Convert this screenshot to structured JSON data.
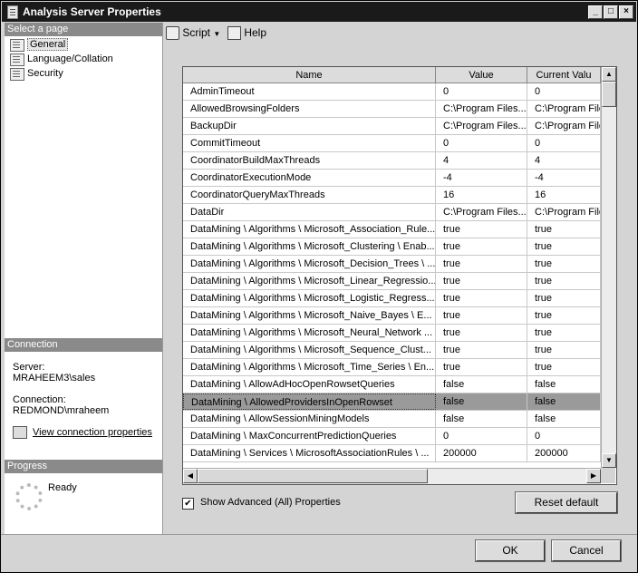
{
  "window": {
    "title": "Analysis Server Properties",
    "min": "_",
    "max": "□",
    "close": "×"
  },
  "sidebar": {
    "select_page_header": "Select a page",
    "pages": [
      {
        "label": "General",
        "selected": true
      },
      {
        "label": "Language/Collation",
        "selected": false
      },
      {
        "label": "Security",
        "selected": false
      }
    ],
    "connection_header": "Connection",
    "server_label": "Server:",
    "server_value": "MRAHEEM3\\sales",
    "connection_label": "Connection:",
    "connection_value": "REDMOND\\mraheem",
    "view_link": "View connection properties",
    "progress_header": "Progress",
    "progress_status": "Ready"
  },
  "toolbar": {
    "script_label": "Script",
    "help_label": "Help"
  },
  "grid": {
    "columns": [
      "Name",
      "Value",
      "Current Valu"
    ],
    "rows": [
      [
        "AdminTimeout",
        "0",
        "0"
      ],
      [
        "AllowedBrowsingFolders",
        "C:\\Program Files...",
        "C:\\Program File"
      ],
      [
        "BackupDir",
        "C:\\Program Files...",
        "C:\\Program File"
      ],
      [
        "CommitTimeout",
        "0",
        "0"
      ],
      [
        "CoordinatorBuildMaxThreads",
        "4",
        "4"
      ],
      [
        "CoordinatorExecutionMode",
        "-4",
        "-4"
      ],
      [
        "CoordinatorQueryMaxThreads",
        "16",
        "16"
      ],
      [
        "DataDir",
        "C:\\Program Files...",
        "C:\\Program File"
      ],
      [
        "DataMining \\ Algorithms \\ Microsoft_Association_Rule...",
        "true",
        "true"
      ],
      [
        "DataMining \\ Algorithms \\ Microsoft_Clustering \\ Enab...",
        "true",
        "true"
      ],
      [
        "DataMining \\ Algorithms \\ Microsoft_Decision_Trees \\ ...",
        "true",
        "true"
      ],
      [
        "DataMining \\ Algorithms \\ Microsoft_Linear_Regressio...",
        "true",
        "true"
      ],
      [
        "DataMining \\ Algorithms \\ Microsoft_Logistic_Regress...",
        "true",
        "true"
      ],
      [
        "DataMining \\ Algorithms \\ Microsoft_Naive_Bayes \\ E...",
        "true",
        "true"
      ],
      [
        "DataMining \\ Algorithms \\ Microsoft_Neural_Network ...",
        "true",
        "true"
      ],
      [
        "DataMining \\ Algorithms \\ Microsoft_Sequence_Clust...",
        "true",
        "true"
      ],
      [
        "DataMining \\ Algorithms \\ Microsoft_Time_Series \\ En...",
        "true",
        "true"
      ],
      [
        "DataMining \\ AllowAdHocOpenRowsetQueries",
        "false",
        "false"
      ],
      [
        "DataMining \\ AllowedProvidersInOpenRowset",
        "false",
        "false"
      ],
      [
        "DataMining \\ AllowSessionMiningModels",
        "false",
        "false"
      ],
      [
        "DataMining \\ MaxConcurrentPredictionQueries",
        "0",
        "0"
      ],
      [
        "DataMining \\ Services \\ MicrosoftAssociationRules \\ ...",
        "200000",
        "200000"
      ]
    ],
    "selected_row": 18
  },
  "footer": {
    "show_advanced_label": "Show Advanced (All) Properties",
    "show_advanced_checked": true,
    "reset_label": "Reset default",
    "ok_label": "OK",
    "cancel_label": "Cancel"
  }
}
